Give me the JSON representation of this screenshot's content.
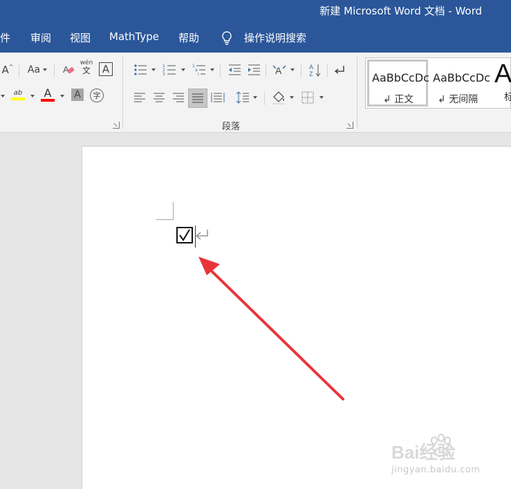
{
  "window": {
    "title": "新建 Microsoft Word 文档  -  Word"
  },
  "menu": {
    "items": [
      "件",
      "审阅",
      "视图",
      "MathType",
      "帮助"
    ],
    "search_label": "操作说明搜索"
  },
  "ribbon": {
    "font_group": {
      "grow_font": "A",
      "change_case": "Aa",
      "phonetic": "wén",
      "char_border": "A",
      "font_color_letter": "A",
      "char_shading": "A",
      "enclose_char": "字",
      "highlight_letters": "ab"
    },
    "paragraph_group": {
      "label": "段落"
    },
    "styles": {
      "sample_text": "AaBbCcDc",
      "items": [
        "正文",
        "无间隔",
        "标"
      ],
      "big_sample": "A"
    }
  },
  "document": {
    "checkbox_symbol": "✓"
  },
  "watermark": {
    "brand": "Bai经验",
    "url": "jingyan.baidu.com"
  },
  "colors": {
    "titlebar": "#2b579a",
    "highlight": "#ffff00",
    "font_color": "#ff0000",
    "arrow": "#e8353a"
  }
}
